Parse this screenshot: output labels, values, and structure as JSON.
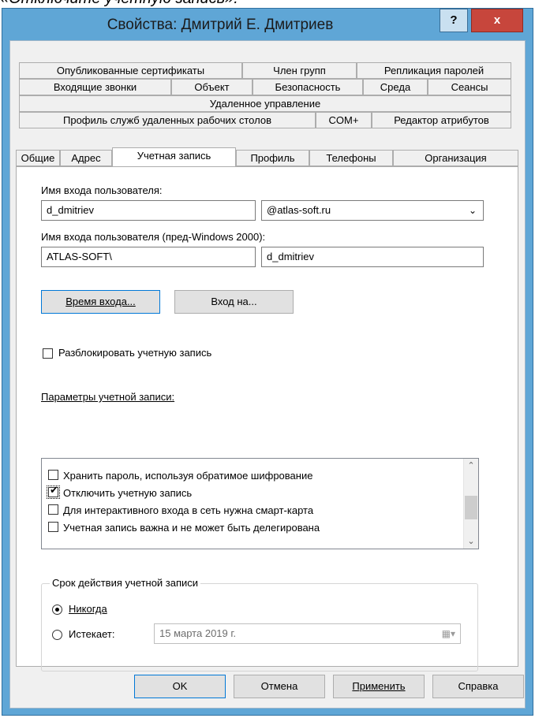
{
  "caption": "«Отключите учетную запись».",
  "window": {
    "title": "Свойства: Дмитрий Е. Дмитриев",
    "help_label": "?",
    "close_label": "x"
  },
  "tabs": {
    "row1": [
      "Опубликованные сертификаты",
      "Член групп",
      "Репликация паролей"
    ],
    "row2": [
      "Входящие звонки",
      "Объект",
      "Безопасность",
      "Среда",
      "Сеансы"
    ],
    "row3": [
      "Удаленное управление"
    ],
    "row4": [
      "Профиль служб удаленных рабочих столов",
      "COM+",
      "Редактор атрибутов"
    ],
    "row5": [
      "Общие",
      "Адрес",
      "Учетная запись",
      "Профиль",
      "Телефоны",
      "Организация"
    ],
    "active": "Учетная запись"
  },
  "account": {
    "logon_name_label": "Имя входа пользователя:",
    "logon_name_value": "d_dmitriev",
    "domain_suffix": "@atlas-soft.ru",
    "pre2000_label": "Имя входа пользователя (пред-Windows 2000):",
    "pre2000_domain": "ATLAS-SOFT\\",
    "pre2000_name": "d_dmitriev",
    "logon_hours_button": "Время входа...",
    "logon_to_button": "Вход на...",
    "unlock_label": "Разблокировать учетную запись",
    "unlock_checked": false,
    "options_label": "Параметры учетной записи:",
    "options": [
      {
        "label": "Хранить пароль, используя обратимое шифрование",
        "checked": false
      },
      {
        "label": "Отключить учетную запись",
        "checked": true
      },
      {
        "label": "Для интерактивного входа в сеть нужна смарт-карта",
        "checked": false
      },
      {
        "label": "Учетная запись важна и не может быть делегирована",
        "checked": false
      }
    ],
    "expires_group_title": "Срок действия учетной записи",
    "never_label": "Никогда",
    "expires_label": "Истекает:",
    "selected_expiry": "never",
    "expiry_date": "15   марта   2019 г."
  },
  "footer": {
    "ok": "OK",
    "cancel": "Отмена",
    "apply": "Применить",
    "help": "Справка"
  }
}
